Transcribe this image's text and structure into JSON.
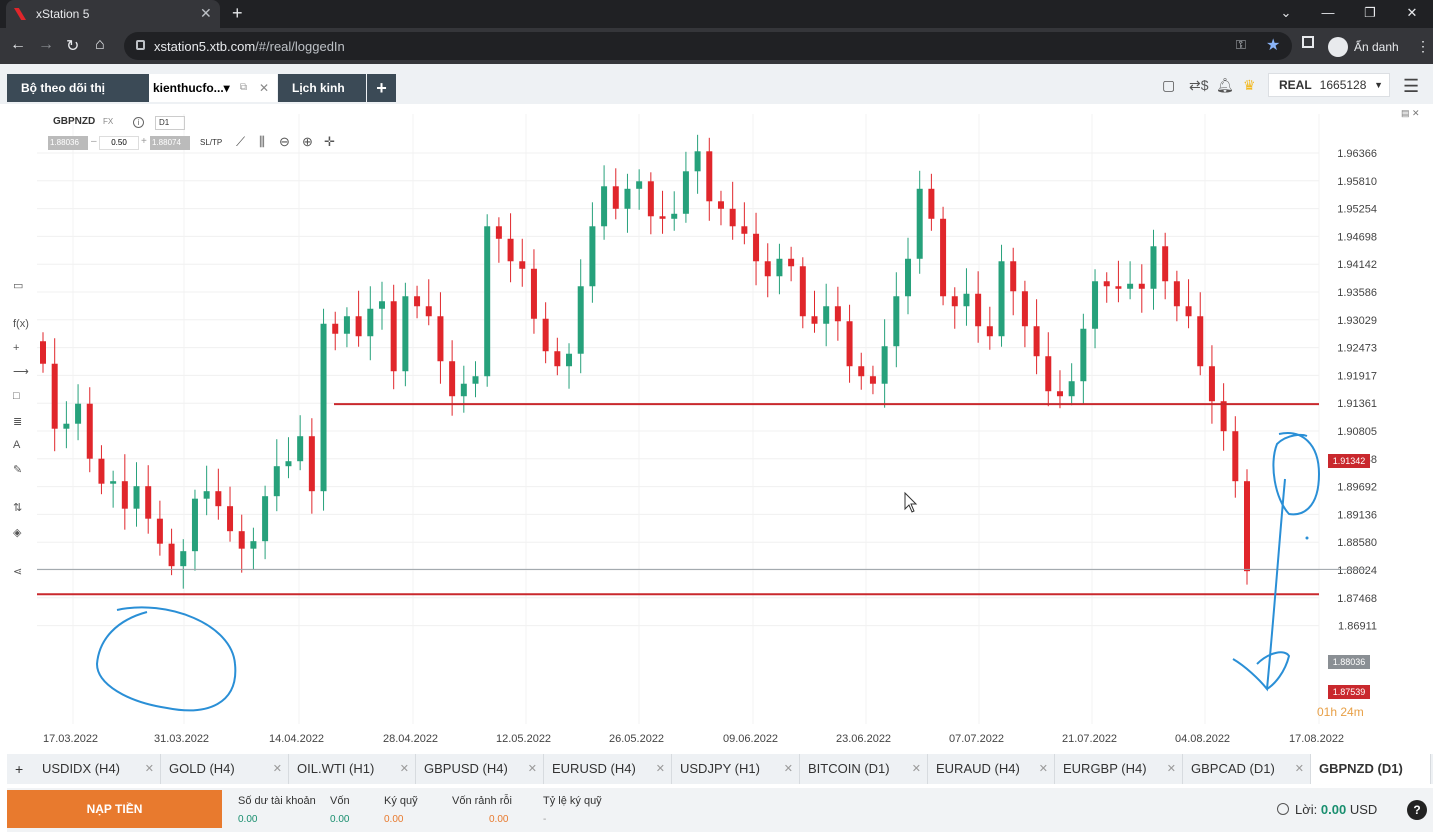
{
  "browser": {
    "tab_title": "xStation 5",
    "url_host": "xstation5.xtb.com",
    "url_path": "/#/real/loggedIn",
    "profile_label": "Ẩn danh"
  },
  "app": {
    "tabs": [
      {
        "label": "Bộ theo dõi thị trường"
      },
      {
        "label": "kienthucfo..."
      },
      {
        "label": "Lịch kinh tế"
      }
    ],
    "account_type": "REAL",
    "account_number": "1665128"
  },
  "chart": {
    "symbol": "GBPNZD",
    "symbol_type": "FX",
    "period": "D1",
    "bid": "1.88036",
    "ask": "1.88074",
    "volume": "0.50",
    "sltp": "SL/TP",
    "timer_label": "01h 24m",
    "flag_upper": "1.91342",
    "flag_current": "1.88036",
    "flag_lower": "1.87539"
  },
  "chart_data": {
    "type": "candlestick",
    "yticks": [
      "1.96366",
      "1.95810",
      "1.95254",
      "1.94698",
      "1.94142",
      "1.93586",
      "1.93029",
      "1.92473",
      "1.91917",
      "1.91361",
      "1.90805",
      "1.90248",
      "1.89692",
      "1.89136",
      "1.88580",
      "1.88024",
      "1.87468",
      "1.86911"
    ],
    "xticks": [
      "17.03.2022",
      "31.03.2022",
      "14.04.2022",
      "28.04.2022",
      "12.05.2022",
      "26.05.2022",
      "09.06.2022",
      "23.06.2022",
      "07.07.2022",
      "21.07.2022",
      "04.08.2022",
      "17.08.2022"
    ],
    "horizontal_lines": [
      1.91342,
      1.88036,
      1.87539
    ],
    "up_color": "#26a17b",
    "down_color": "#e0262b"
  },
  "bottom_tabs": [
    {
      "label": "USDIDX (H4)"
    },
    {
      "label": "GOLD (H4)"
    },
    {
      "label": "OIL.WTI (H1)"
    },
    {
      "label": "GBPUSD (H4)"
    },
    {
      "label": "EURUSD (H4)"
    },
    {
      "label": "USDJPY (H1)"
    },
    {
      "label": "BITCOIN (D1)"
    },
    {
      "label": "EURAUD (H4)"
    },
    {
      "label": "EURGBP (H4)"
    },
    {
      "label": "GBPCAD (D1)"
    },
    {
      "label": "GBPNZD (D1)"
    }
  ],
  "footer": {
    "deposit": "NẠP TIỀN",
    "cols": [
      {
        "label": "Số dư tài khoản",
        "value": "0.00"
      },
      {
        "label": "Vốn",
        "value": "0.00"
      },
      {
        "label": "Ký quỹ",
        "value": "0.00"
      },
      {
        "label": "Vốn rảnh rỗi",
        "value": "0.00"
      },
      {
        "label": "Tỷ lệ ký quỹ",
        "value": "-"
      }
    ],
    "pnl_label": "Lời:",
    "pnl_value": "0.00",
    "pnl_ccy": "USD"
  }
}
